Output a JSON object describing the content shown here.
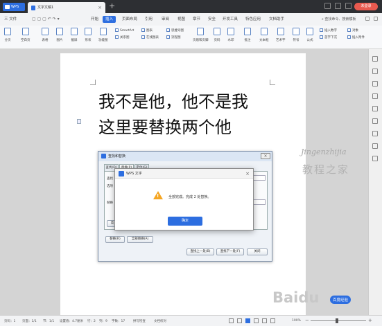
{
  "titlebar": {
    "app_tab": "WPS",
    "doc_tab": "文字文稿1",
    "login_label": "未登录"
  },
  "menubar": {
    "file": "三 文件",
    "items": [
      "开始",
      "插入",
      "页面布局",
      "引用",
      "审阅",
      "视图",
      "章节",
      "安全",
      "开发工具",
      "特色应用",
      "文档助手"
    ],
    "active": "插入",
    "search": "查找命令、搜索模板"
  },
  "ribbon": {
    "big": [
      "分页",
      "空白页",
      "表格",
      "图片",
      "截屏",
      "形状",
      "功能图",
      "页眉和页脚",
      "页码",
      "水印",
      "批注",
      "文本框",
      "艺术字",
      "符号",
      "公式"
    ],
    "small": {
      "smartart": "SmartArt",
      "relation": "关系图",
      "chart": "图表",
      "online_chart": "在线图表",
      "flowchart": "思维导图",
      "flow": "流程图",
      "insert_number": "插入数字",
      "object": "对象",
      "first_drop": "首字下沉",
      "attachment": "插入附件"
    }
  },
  "document": {
    "line1": "我不是他，他不是我",
    "line2": "这里要替换两个他"
  },
  "find_dialog": {
    "title": "查找和替换",
    "close": "×",
    "tabs": [
      "查找(D)",
      "替换(P)",
      "定位(G)"
    ],
    "find_label": "查找",
    "options_label": "选项",
    "replace_label": "替换",
    "high_button": "高",
    "replace_button": "替换(R)",
    "replace_all_button": "全部替换(A)",
    "find_prev": "查找上一处(B)",
    "find_next": "查找下一处(F)",
    "close_button": "关闭"
  },
  "message_box": {
    "title": "WPS 文字",
    "close": "×",
    "message": "全部完成。完成 2 处替换。",
    "ok": "确定"
  },
  "statusbar": {
    "page": "页码：1",
    "pages": "页面：1/1",
    "section": "节：1/1",
    "position": "设置值：4.7厘米",
    "row": "行：2",
    "col": "列：9",
    "words": "字数：17",
    "spell": "拼写检查",
    "compat": "文档校对",
    "zoom": "100%",
    "zoom_value": 100
  },
  "watermark": {
    "domain": "Jingenzhijia",
    "site": "教程之家",
    "baidu": "Baidu",
    "baidu_sub": "百度经验"
  }
}
